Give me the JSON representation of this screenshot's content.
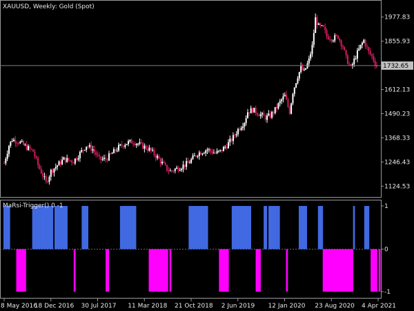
{
  "header": {
    "title": "XAUUSD, Weekly:  Gold (Spot)"
  },
  "indicator": {
    "title": "MaRsi-Trigger() 0 -1"
  },
  "colors": {
    "background": "#000000",
    "candle_up": "#ffffff",
    "candle_down": "#d81b60",
    "bar_positive": "#4169e1",
    "bar_negative": "#ff00ff",
    "current_price_line": "#808080",
    "price_tag_bg": "#c0c0c0"
  },
  "chart_data": [
    {
      "type": "candlestick",
      "symbol": "XAUUSD",
      "timeframe": "Weekly",
      "ylim": [
        1070,
        2060
      ],
      "y_ticks": [
        "1977.83",
        "1855.93",
        "1612.13",
        "1490.23",
        "1368.33",
        "1246.43",
        "1124.53"
      ],
      "current_price": "1732.65",
      "x_tick_labels": [
        "8 May 2016",
        "18 Dec 2016",
        "30 Jul 2017",
        "11 Mar 2018",
        "21 Oct 2018",
        "2 Jun 2019",
        "12 Jan 2020",
        "23 Aug 2020",
        "4 Apr 2021"
      ],
      "close_path": [
        [
          0,
          1240
        ],
        [
          3,
          1330
        ],
        [
          5,
          1360
        ],
        [
          9,
          1350
        ],
        [
          14,
          1320
        ],
        [
          18,
          1300
        ],
        [
          21,
          1230
        ],
        [
          24,
          1180
        ],
        [
          26,
          1140
        ],
        [
          29,
          1200
        ],
        [
          33,
          1230
        ],
        [
          37,
          1260
        ],
        [
          43,
          1250
        ],
        [
          48,
          1300
        ],
        [
          51,
          1330
        ],
        [
          55,
          1310
        ],
        [
          59,
          1260
        ],
        [
          63,
          1260
        ],
        [
          67,
          1290
        ],
        [
          71,
          1320
        ],
        [
          75,
          1340
        ],
        [
          80,
          1350
        ],
        [
          85,
          1330
        ],
        [
          90,
          1310
        ],
        [
          95,
          1270
        ],
        [
          98,
          1240
        ],
        [
          101,
          1210
        ],
        [
          103,
          1200
        ],
        [
          109,
          1220
        ],
        [
          114,
          1240
        ],
        [
          120,
          1290
        ],
        [
          126,
          1310
        ],
        [
          131,
          1290
        ],
        [
          134,
          1300
        ],
        [
          138,
          1330
        ],
        [
          142,
          1370
        ],
        [
          145,
          1410
        ],
        [
          149,
          1450
        ],
        [
          151,
          1500
        ],
        [
          154,
          1510
        ],
        [
          158,
          1490
        ],
        [
          162,
          1470
        ],
        [
          165,
          1480
        ],
        [
          168,
          1510
        ],
        [
          172,
          1560
        ],
        [
          174,
          1580
        ],
        [
          177,
          1500
        ],
        [
          179,
          1600
        ],
        [
          182,
          1680
        ],
        [
          184,
          1720
        ],
        [
          186,
          1700
        ],
        [
          189,
          1760
        ],
        [
          191,
          1830
        ],
        [
          193,
          1970
        ],
        [
          195,
          1930
        ],
        [
          198,
          1920
        ],
        [
          200,
          1880
        ],
        [
          204,
          1870
        ],
        [
          207,
          1880
        ],
        [
          210,
          1830
        ],
        [
          212,
          1770
        ],
        [
          215,
          1720
        ],
        [
          218,
          1780
        ],
        [
          221,
          1830
        ],
        [
          223,
          1860
        ],
        [
          226,
          1800
        ],
        [
          228,
          1780
        ],
        [
          231,
          1730
        ]
      ]
    },
    {
      "type": "bar",
      "title": "MaRsi-Trigger() 0 -1",
      "ylim": [
        -1,
        1
      ],
      "y_ticks": [
        "1",
        "0",
        "-1"
      ],
      "values": [
        1,
        1,
        1,
        1,
        0,
        0,
        0,
        0,
        -1,
        -1,
        -1,
        -1,
        -1,
        -1,
        0,
        0,
        0,
        0,
        1,
        1,
        1,
        1,
        1,
        1,
        1,
        1,
        1,
        1,
        1,
        1,
        1,
        0,
        1,
        1,
        1,
        1,
        1,
        1,
        1,
        1,
        0,
        0,
        0,
        0,
        -1,
        0,
        0,
        0,
        0,
        1,
        1,
        1,
        1,
        0,
        0,
        0,
        0,
        0,
        0,
        0,
        0,
        0,
        0,
        0,
        -1,
        -1,
        0,
        0,
        0,
        0,
        0,
        0,
        0,
        1,
        1,
        1,
        1,
        1,
        1,
        1,
        1,
        1,
        1,
        0,
        0,
        0,
        0,
        0,
        0,
        0,
        0,
        -1,
        -1,
        -1,
        -1,
        -1,
        -1,
        -1,
        -1,
        -1,
        -1,
        -1,
        -1,
        0,
        -1,
        0,
        0,
        0,
        0,
        0,
        0,
        0,
        0,
        0,
        0,
        0,
        1,
        1,
        1,
        1,
        1,
        1,
        1,
        1,
        1,
        1,
        1,
        1,
        0,
        0,
        0,
        0,
        0,
        0,
        0,
        -1,
        -1,
        -1,
        -1,
        -1,
        -1,
        0,
        0,
        1,
        1,
        1,
        1,
        1,
        1,
        1,
        1,
        1,
        1,
        1,
        1,
        0,
        0,
        0,
        -1,
        -1,
        -1,
        0,
        0,
        1,
        1,
        0,
        1,
        1,
        1,
        1,
        1,
        1,
        1,
        0,
        0,
        0,
        0,
        -1,
        0,
        0,
        0,
        0,
        0,
        0,
        0,
        1,
        1,
        1,
        1,
        1,
        0,
        0,
        0,
        0,
        0,
        0,
        0,
        1,
        1,
        1,
        -1,
        -1,
        -1,
        -1,
        -1,
        -1,
        -1,
        -1,
        -1,
        -1,
        -1,
        -1,
        -1,
        -1,
        -1,
        -1,
        -1,
        -1,
        -1,
        1,
        0,
        0,
        0,
        0,
        0,
        0,
        1,
        1,
        1,
        0,
        -1,
        -1,
        -1,
        -1,
        0,
        -1
      ]
    }
  ]
}
